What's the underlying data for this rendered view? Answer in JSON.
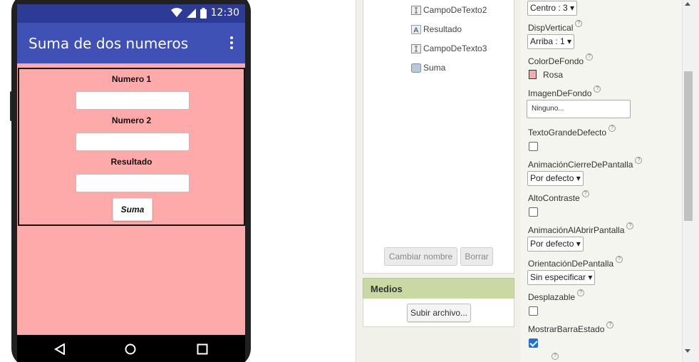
{
  "phone": {
    "status_time": "12:30",
    "app_title": "Suma de dos numeros",
    "labels": {
      "numero1": "Numero 1",
      "numero2": "Numero 2",
      "resultado": "Resultado"
    },
    "suma_button": "Suma",
    "screen_color": "#ffaaaa",
    "appbar_color": "#3f51b5"
  },
  "components": {
    "items": [
      {
        "label": "CampoDeTexto2",
        "icon": "textbox-icon"
      },
      {
        "label": "Resultado",
        "icon": "label-icon"
      },
      {
        "label": "CampoDeTexto3",
        "icon": "textbox-icon"
      },
      {
        "label": "Suma",
        "icon": "button-icon"
      }
    ],
    "rename_button": "Cambiar nombre",
    "delete_button": "Borrar",
    "media_header": "Medios",
    "upload_button": "Subir archivo..."
  },
  "properties": {
    "align_h_value": "Centro : 3 ▾",
    "align_v_label": "DispVertical",
    "align_v_value": "Arriba : 1 ▾",
    "bg_color_label": "ColorDeFondo",
    "bg_color_value": "Rosa",
    "bg_image_label": "ImagenDeFondo",
    "bg_image_value": "Ninguno...",
    "big_text_label": "TextoGrandeDefecto",
    "big_text_checked": false,
    "close_anim_label": "AnimaciónCierreDePantalla",
    "close_anim_value": "Por defecto ▾",
    "high_contrast_label": "AltoContraste",
    "high_contrast_checked": false,
    "open_anim_label": "AnimaciónAlAbrirPantalla",
    "open_anim_value": "Por defecto ▾",
    "orientation_label": "OrientaciónDePantalla",
    "orientation_value": "Sin especificar ▾",
    "scrollable_label": "Desplazable",
    "scrollable_checked": false,
    "status_bar_label": "MostrarBarraEstado",
    "status_bar_checked": true
  }
}
